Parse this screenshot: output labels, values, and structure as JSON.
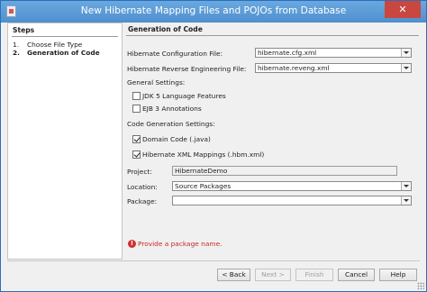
{
  "window": {
    "title": "New Hibernate Mapping Files and POJOs from Database",
    "close_glyph": "✕"
  },
  "steps": {
    "title": "Steps",
    "items": [
      {
        "num": "1.",
        "label": "Choose File Type",
        "current": false
      },
      {
        "num": "2.",
        "label": "Generation of Code",
        "current": true
      }
    ]
  },
  "main": {
    "title": "Generation of Code",
    "config_file": {
      "label": "Hibernate Configuration File:",
      "value": "hibernate.cfg.xml"
    },
    "reveng_file": {
      "label": "Hibernate Reverse Engineering File:",
      "value": "hibernate.reveng.xml"
    },
    "general_settings": {
      "label": "General Settings:",
      "jdk5": {
        "label": "JDK 5 Language Features",
        "checked": false
      },
      "ejb3": {
        "label": "EJB 3 Annotations",
        "checked": false
      }
    },
    "code_generation": {
      "label": "Code Generation Settings:",
      "domain_code": {
        "label": "Domain Code (.java)",
        "checked": true
      },
      "xml_mappings": {
        "label": "Hibernate XML Mappings (.hbm.xml)",
        "checked": true
      }
    },
    "project": {
      "label": "Project:",
      "value": "HibernateDemo"
    },
    "location": {
      "label": "Location:",
      "value": "Source Packages"
    },
    "package": {
      "label": "Package:",
      "value": ""
    },
    "error": {
      "icon": "!",
      "message": "Provide a package name."
    }
  },
  "buttons": {
    "back": "< Back",
    "next": "Next >",
    "finish": "Finish",
    "cancel": "Cancel",
    "help": "Help"
  }
}
